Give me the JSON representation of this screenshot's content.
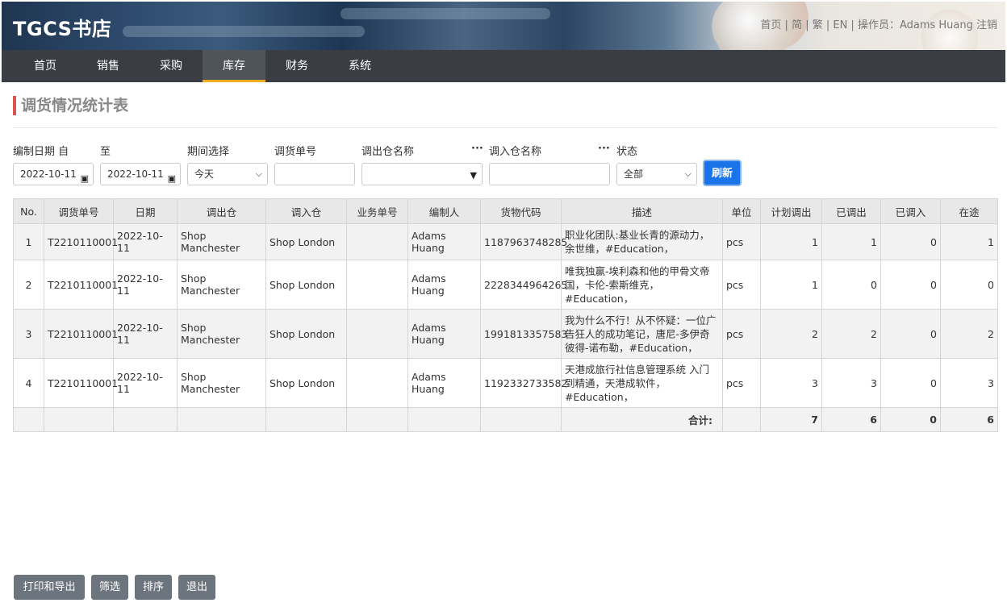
{
  "header": {
    "logo": "TGCS书店",
    "toplinks": "首页 | 简 | 繁 | EN | 操作员：Adams Huang  注销"
  },
  "nav": [
    "首页",
    "销售",
    "采购",
    "库存",
    "财务",
    "系统"
  ],
  "page_title": "调货情况统计表",
  "filters": {
    "date_from_label": "编制日期 自",
    "date_to_label": "至",
    "period_label": "期间选择",
    "transfer_no_label": "调货单号",
    "out_warehouse_label": "调出仓名称",
    "in_warehouse_label": "调入仓名称",
    "status_label": "状态",
    "date_from": "2022-10-11",
    "date_to": "2022-10-11",
    "period_value": "今天",
    "status_value": "全部",
    "refresh_label": "刷新",
    "dots": "···"
  },
  "table": {
    "headers": [
      "No.",
      "调货单号",
      "日期",
      "调出仓",
      "调入仓",
      "业务单号",
      "编制人",
      "货物代码",
      "描述",
      "单位",
      "计划调出",
      "已调出",
      "已调入",
      "在途"
    ],
    "rows": [
      [
        "1",
        "T2210110001",
        "2022-10-11",
        "Shop Manchester",
        "Shop London",
        "",
        "Adams Huang",
        "1187963748285",
        "职业化团队:基业长青的源动力，余世维，#Education，",
        "pcs",
        "1",
        "1",
        "0",
        "1"
      ],
      [
        "2",
        "T2210110001",
        "2022-10-11",
        "Shop Manchester",
        "Shop London",
        "",
        "Adams Huang",
        "2228344964265",
        "唯我独赢-埃利森和他的甲骨文帝国，卡伦-索斯维克，#Education，",
        "pcs",
        "1",
        "0",
        "0",
        "0"
      ],
      [
        "3",
        "T2210110001",
        "2022-10-11",
        "Shop Manchester",
        "Shop London",
        "",
        "Adams Huang",
        "1991813357583",
        "我为什么不行！从不怀疑：一位广告狂人的成功笔记，唐尼-多伊奇 彼得-诺布勒，#Education，",
        "pcs",
        "2",
        "2",
        "0",
        "2"
      ],
      [
        "4",
        "T2210110001",
        "2022-10-11",
        "Shop Manchester",
        "Shop London",
        "",
        "Adams Huang",
        "1192332733582",
        "天港成旅行社信息管理系统 入门到精通，天港成软件，#Education，",
        "pcs",
        "3",
        "3",
        "0",
        "3"
      ]
    ],
    "total_label": "合计:",
    "totals": {
      "planned": "7",
      "out": "6",
      "in": "0",
      "transit": "6"
    }
  },
  "buttons": {
    "print": "打印和导出",
    "filter": "筛选",
    "sort": "排序",
    "exit": "退出"
  }
}
